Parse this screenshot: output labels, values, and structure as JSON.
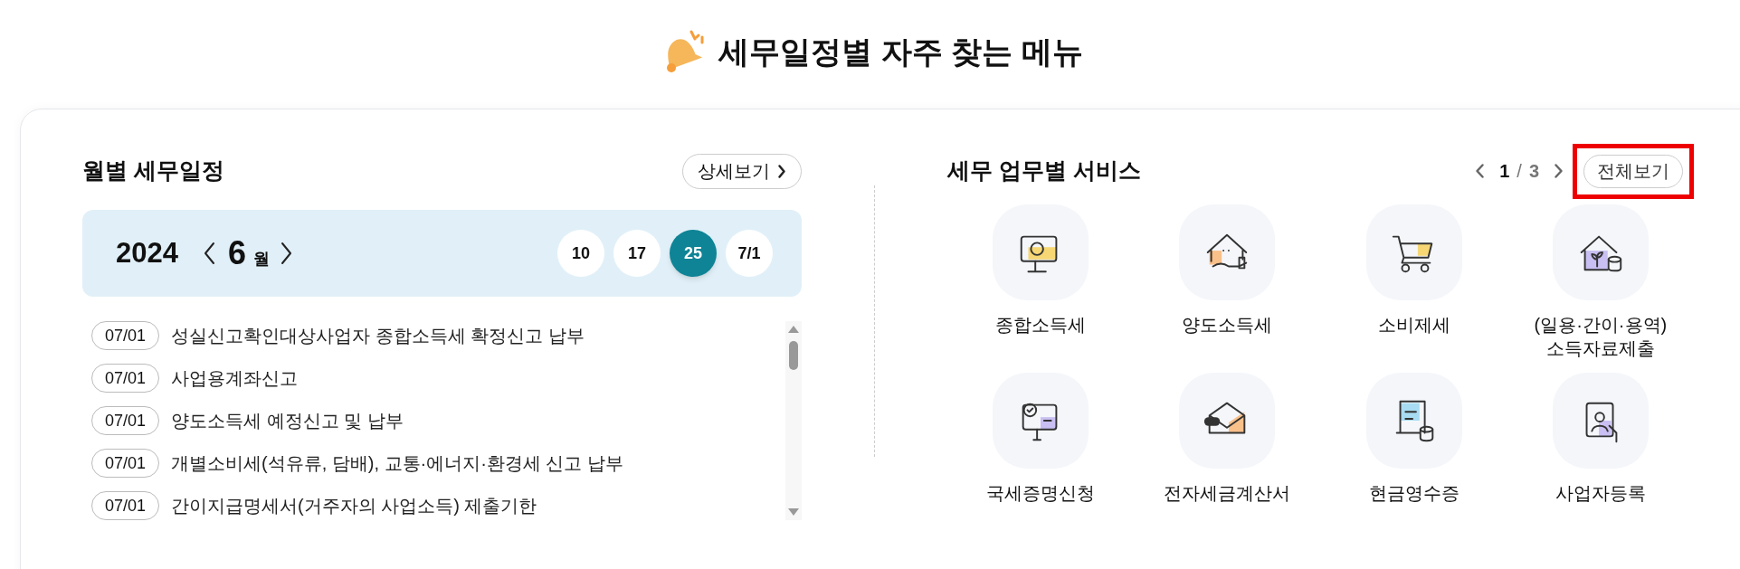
{
  "header": {
    "title": "세무일정별 자주 찾는 메뉴"
  },
  "schedule": {
    "title": "월별 세무일정",
    "detail_button": "상세보기",
    "year": "2024",
    "month": "6",
    "month_unit": "월",
    "days": [
      {
        "label": "10",
        "selected": false
      },
      {
        "label": "17",
        "selected": false
      },
      {
        "label": "25",
        "selected": true
      },
      {
        "label": "7/1",
        "selected": false
      }
    ],
    "items": [
      {
        "date": "07/01",
        "text": "성실신고확인대상사업자 종합소득세 확정신고 납부"
      },
      {
        "date": "07/01",
        "text": "사업용계좌신고"
      },
      {
        "date": "07/01",
        "text": "양도소득세 예정신고 및 납부"
      },
      {
        "date": "07/01",
        "text": "개별소비세(석유류, 담배), 교통·에너지·환경세 신고 납부"
      },
      {
        "date": "07/01",
        "text": "간이지급명세서(거주자의 사업소득) 제출기한"
      }
    ]
  },
  "services": {
    "title": "세무 업무별 서비스",
    "page": "1",
    "page_separator": "/",
    "total": "3",
    "all_button": "전체보기",
    "all_button_highlighted": true,
    "items": [
      {
        "label": "종합소득세"
      },
      {
        "label": "양도소득세"
      },
      {
        "label": "소비제세"
      },
      {
        "label": "(일용·간이·용역)\n소득자료제출"
      },
      {
        "label": "국세증명신청"
      },
      {
        "label": "전자세금계산서"
      },
      {
        "label": "현금영수증"
      },
      {
        "label": "사업자등록"
      }
    ]
  }
}
